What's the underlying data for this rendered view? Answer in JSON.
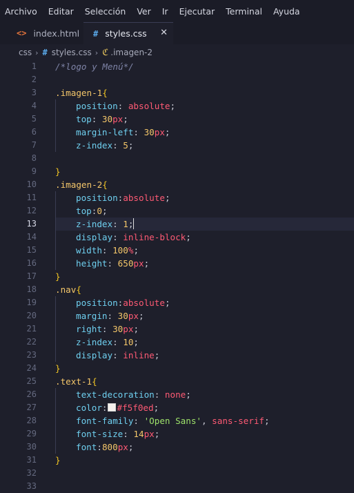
{
  "menubar": {
    "items": [
      "Archivo",
      "Editar",
      "Selección",
      "Ver",
      "Ir",
      "Ejecutar",
      "Terminal",
      "Ayuda"
    ]
  },
  "tabs": [
    {
      "label": "index.html",
      "icon": "<>",
      "icon_name": "html-file-icon"
    },
    {
      "label": "styles.css",
      "icon": "#",
      "icon_name": "css-file-icon",
      "close": "✕"
    }
  ],
  "breadcrumb": {
    "folder": "css",
    "file": "styles.css",
    "symbol": ".imagen-2",
    "chevron": "›",
    "file_icon": "#",
    "symbol_icon": "ℭ"
  },
  "editor": {
    "active_line": 13,
    "lines": [
      [
        [
          "c-comment",
          "/*logo y Menú*/"
        ]
      ],
      [],
      [
        [
          "c-sel",
          ".imagen-1"
        ],
        [
          "c-brace",
          "{"
        ]
      ],
      [
        [
          "c-prop",
          "position"
        ],
        [
          "c-punc",
          ": "
        ],
        [
          "c-val",
          "absolute"
        ],
        [
          "c-punc",
          ";"
        ]
      ],
      [
        [
          "c-prop",
          "top"
        ],
        [
          "c-punc",
          ": "
        ],
        [
          "c-num",
          "30"
        ],
        [
          "c-unit",
          "px"
        ],
        [
          "c-punc",
          ";"
        ]
      ],
      [
        [
          "c-prop",
          "margin-left"
        ],
        [
          "c-punc",
          ": "
        ],
        [
          "c-num",
          "30"
        ],
        [
          "c-unit",
          "px"
        ],
        [
          "c-punc",
          ";"
        ]
      ],
      [
        [
          "c-prop",
          "z-index"
        ],
        [
          "c-punc",
          ": "
        ],
        [
          "c-num",
          "5"
        ],
        [
          "c-punc",
          ";"
        ]
      ],
      [],
      [
        [
          "c-brace",
          "}"
        ]
      ],
      [
        [
          "c-sel",
          ".imagen-2"
        ],
        [
          "c-brace",
          "{"
        ]
      ],
      [
        [
          "c-prop",
          "position"
        ],
        [
          "c-punc",
          ":"
        ],
        [
          "c-val",
          "absolute"
        ],
        [
          "c-punc",
          ";"
        ]
      ],
      [
        [
          "c-prop",
          "top"
        ],
        [
          "c-punc",
          ":"
        ],
        [
          "c-num",
          "0"
        ],
        [
          "c-punc",
          ";"
        ]
      ],
      [
        [
          "c-prop",
          "z-index"
        ],
        [
          "c-punc",
          ": "
        ],
        [
          "c-num",
          "1"
        ],
        [
          "c-punc",
          ";"
        ],
        [
          "cursor",
          ""
        ]
      ],
      [
        [
          "c-prop",
          "display"
        ],
        [
          "c-punc",
          ": "
        ],
        [
          "c-val",
          "inline-block"
        ],
        [
          "c-punc",
          ";"
        ]
      ],
      [
        [
          "c-prop",
          "width"
        ],
        [
          "c-punc",
          ": "
        ],
        [
          "c-num",
          "100"
        ],
        [
          "c-unit",
          "%"
        ],
        [
          "c-punc",
          ";"
        ]
      ],
      [
        [
          "c-prop",
          "height"
        ],
        [
          "c-punc",
          ": "
        ],
        [
          "c-num",
          "650"
        ],
        [
          "c-unit",
          "px"
        ],
        [
          "c-punc",
          ";"
        ]
      ],
      [
        [
          "c-brace",
          "}"
        ]
      ],
      [
        [
          "c-sel",
          ".nav"
        ],
        [
          "c-brace",
          "{"
        ]
      ],
      [
        [
          "c-prop",
          "position"
        ],
        [
          "c-punc",
          ":"
        ],
        [
          "c-val",
          "absolute"
        ],
        [
          "c-punc",
          ";"
        ]
      ],
      [
        [
          "c-prop",
          "margin"
        ],
        [
          "c-punc",
          ": "
        ],
        [
          "c-num",
          "30"
        ],
        [
          "c-unit",
          "px"
        ],
        [
          "c-punc",
          ";"
        ]
      ],
      [
        [
          "c-prop",
          "right"
        ],
        [
          "c-punc",
          ": "
        ],
        [
          "c-num",
          "30"
        ],
        [
          "c-unit",
          "px"
        ],
        [
          "c-punc",
          ";"
        ]
      ],
      [
        [
          "c-prop",
          "z-index"
        ],
        [
          "c-punc",
          ": "
        ],
        [
          "c-num",
          "10"
        ],
        [
          "c-punc",
          ";"
        ]
      ],
      [
        [
          "c-prop",
          "display"
        ],
        [
          "c-punc",
          ": "
        ],
        [
          "c-val",
          "inline"
        ],
        [
          "c-punc",
          ";"
        ]
      ],
      [
        [
          "c-brace",
          "}"
        ]
      ],
      [
        [
          "c-sel",
          ".text-1"
        ],
        [
          "c-brace",
          "{"
        ]
      ],
      [
        [
          "c-prop",
          "text-decoration"
        ],
        [
          "c-punc",
          ": "
        ],
        [
          "c-val",
          "none"
        ],
        [
          "c-punc",
          ";"
        ]
      ],
      [
        [
          "c-prop",
          "color"
        ],
        [
          "c-punc",
          ":"
        ],
        [
          "swatch",
          "#f5f0ed"
        ],
        [
          "c-val",
          "#f5f0ed"
        ],
        [
          "c-punc",
          ";"
        ]
      ],
      [
        [
          "c-prop",
          "font-family"
        ],
        [
          "c-punc",
          ": "
        ],
        [
          "c-str",
          "'Open Sans'"
        ],
        [
          "c-punc",
          ", "
        ],
        [
          "c-val",
          "sans-serif"
        ],
        [
          "c-punc",
          ";"
        ]
      ],
      [
        [
          "c-prop",
          "font-size"
        ],
        [
          "c-punc",
          ": "
        ],
        [
          "c-num",
          "14"
        ],
        [
          "c-unit",
          "px"
        ],
        [
          "c-punc",
          ";"
        ]
      ],
      [
        [
          "c-prop",
          "font"
        ],
        [
          "c-punc",
          ":"
        ],
        [
          "c-num",
          "800"
        ],
        [
          "c-unit",
          "px"
        ],
        [
          "c-punc",
          ";"
        ]
      ],
      [
        [
          "c-brace",
          "}"
        ]
      ],
      [],
      []
    ]
  }
}
